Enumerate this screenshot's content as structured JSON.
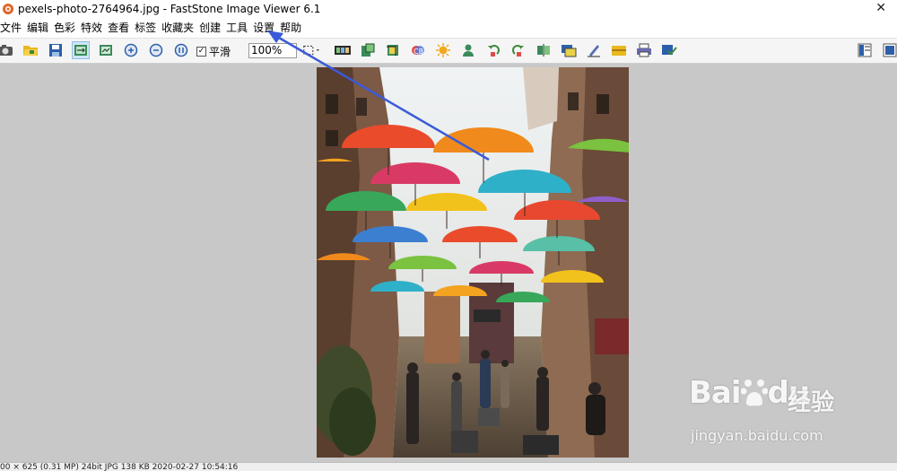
{
  "window": {
    "title": "pexels-photo-2764964.jpg  -  FastStone Image Viewer 6.1",
    "close_glyph": "✕"
  },
  "menu": [
    "文件",
    "编辑",
    "色彩",
    "特效",
    "查看",
    "标签",
    "收藏夹",
    "创建",
    "工具",
    "设置",
    "帮助"
  ],
  "toolbar": {
    "smooth_label": "平滑",
    "smooth_checked": true,
    "zoom_value": "100%",
    "icons": [
      "camera-icon",
      "open-folder-icon",
      "save-icon",
      "fit-window-icon",
      "actual-size-icon",
      "zoom-in-icon",
      "zoom-out-icon",
      "one-to-one-icon",
      "select-rect-icon",
      "slideshow-icon",
      "resize-icon",
      "crop-icon",
      "color-icon",
      "brightness-icon",
      "person-icon",
      "rotate-left-icon",
      "rotate-right-icon",
      "flip-icon",
      "compare-icon",
      "draw-icon",
      "wallpaper-icon",
      "print-icon",
      "batch-icon",
      "panel-layout-icon",
      "fullscreen-icon"
    ]
  },
  "status": {
    "text": "00 × 625 (0.31 MP)  24bit  JPG   138 KB   2020-02-27 10:54:16"
  },
  "watermark": {
    "logo": "Bai",
    "logo_suffix": "du",
    "chinese": "经验",
    "url": "jingyan.baidu.com"
  },
  "colors": {
    "arrow": "#3a5bd9",
    "active_button": "#cfe5f7"
  }
}
